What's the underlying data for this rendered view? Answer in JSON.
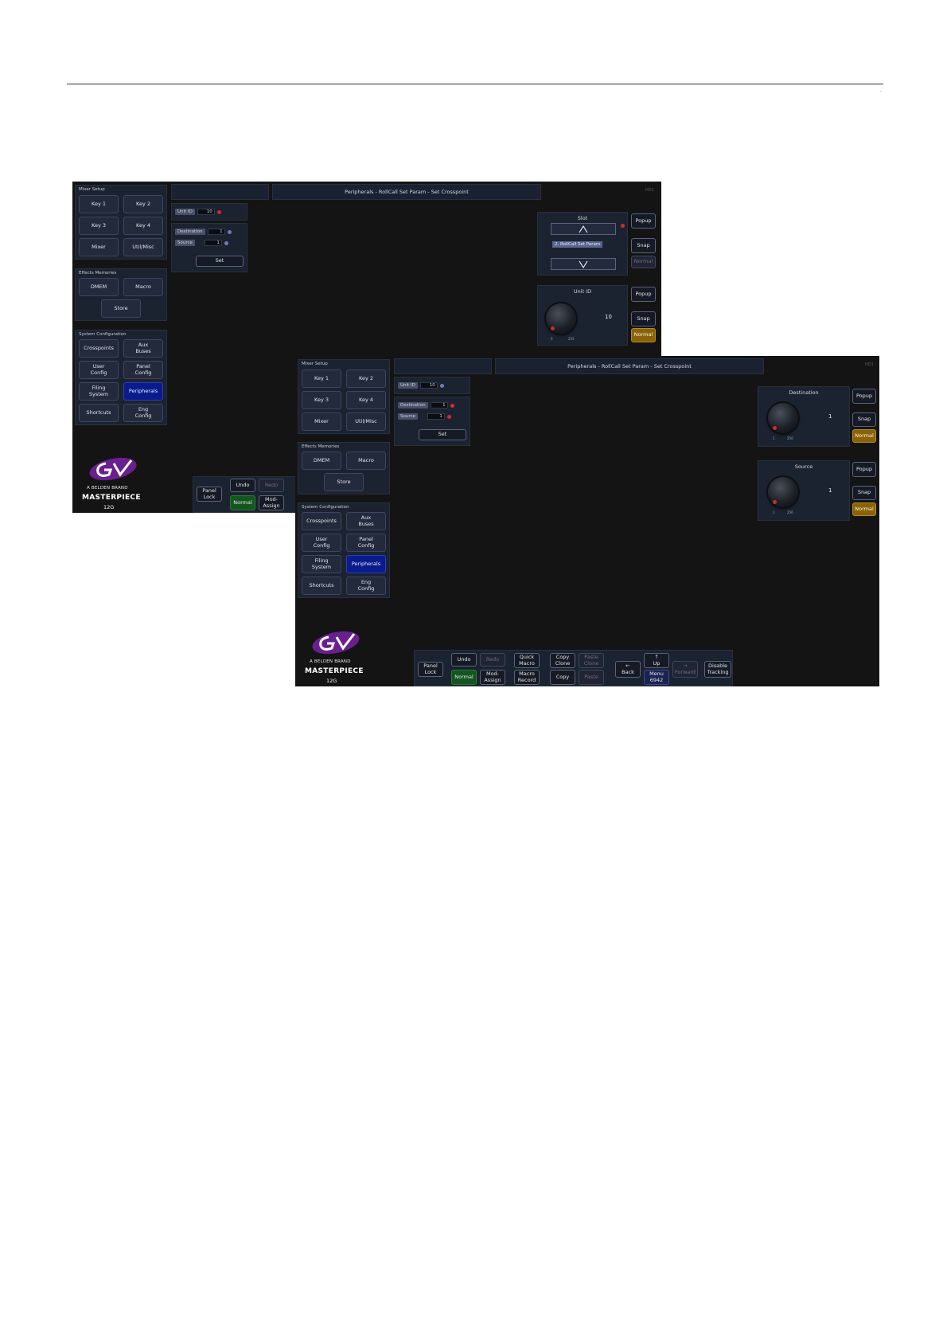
{
  "page": {
    "mark": ","
  },
  "screen1": {
    "header_title": "Peripherals - RollCall Set Param - Set Crosspoint",
    "corner_label": "HD1",
    "mixer_setup": {
      "title": "Mixer Setup",
      "buttons": [
        "Key 1",
        "Key 2",
        "Key 3",
        "Key 4",
        "Mixer",
        "Util/Misc"
      ]
    },
    "effects_memories": {
      "title": "Effects Memories",
      "buttons": [
        "DMEM",
        "Macro",
        "Store"
      ]
    },
    "system_config": {
      "title": "System Configuration",
      "buttons": [
        "Crosspoints",
        "Aux\nBuses",
        "User\nConfig",
        "Panel\nConfig",
        "Filing\nSystem",
        "Peripherals",
        "Shortcuts",
        "Eng\nConfig"
      ]
    },
    "params": {
      "unit_id_label": "Unit ID",
      "unit_id_value": "10",
      "dest_label": "Destination",
      "dest_value": "1",
      "source_label": "Source",
      "source_value": "1",
      "set_label": "Set"
    },
    "slot": {
      "title": "Slot",
      "selected": "2. RollCall Set Param",
      "popup": "Popup",
      "snap": "Snap",
      "normal": "Normal"
    },
    "unit_id_knob": {
      "title": "Unit ID",
      "value": "10",
      "min": "0",
      "max": "255",
      "popup": "Popup",
      "snap": "Snap",
      "normal": "Normal"
    },
    "bottom": {
      "panel_lock": "Panel\nLock",
      "undo": "Undo",
      "redo": "Redo",
      "normal": "Normal",
      "mod_assign": "Mod-\nAssign"
    },
    "brand": {
      "sub": "A BELDEN BRAND",
      "main": "MASTERPIECE",
      "model": "12G"
    }
  },
  "screen2": {
    "header_title": "Peripherals - RollCall Set Param - Set Crosspoint",
    "corner_label": "HD1",
    "mixer_setup": {
      "title": "Mixer Setup",
      "buttons": [
        "Key 1",
        "Key 2",
        "Key 3",
        "Key 4",
        "Mixer",
        "Util/Misc"
      ]
    },
    "effects_memories": {
      "title": "Effects Memories",
      "buttons": [
        "DMEM",
        "Macro",
        "Store"
      ]
    },
    "system_config": {
      "title": "System Configuration",
      "buttons": [
        "Crosspoints",
        "Aux\nBuses",
        "User\nConfig",
        "Panel\nConfig",
        "Filing\nSystem",
        "Peripherals",
        "Shortcuts",
        "Eng\nConfig"
      ]
    },
    "params": {
      "unit_id_label": "Unit ID",
      "unit_id_value": "10",
      "dest_label": "Destination",
      "dest_value": "1",
      "source_label": "Source",
      "source_value": "1",
      "set_label": "Set"
    },
    "destination_knob": {
      "title": "Destination",
      "value": "1",
      "min": "1",
      "max": "256",
      "popup": "Popup",
      "snap": "Snap",
      "normal": "Normal"
    },
    "source_knob": {
      "title": "Source",
      "value": "1",
      "min": "1",
      "max": "256",
      "popup": "Popup",
      "snap": "Snap",
      "normal": "Normal"
    },
    "bottom": {
      "panel_lock": "Panel\nLock",
      "undo": "Undo",
      "redo": "Redo",
      "normal": "Normal",
      "mod_assign": "Mod-\nAssign",
      "quick_macro": "Quick\nMacro",
      "macro_record": "Macro\nRecord",
      "copy_clone": "Copy\nClone",
      "paste_clone": "Paste\nClone",
      "copy": "Copy",
      "paste": "Paste",
      "back": "Back",
      "up": "Up",
      "menu": "Menu\n6942",
      "forward": "Forward",
      "disable_tracking": "Disable\nTracking"
    },
    "brand": {
      "sub": "A BELDEN BRAND",
      "main": "MASTERPIECE",
      "model": "12G"
    }
  }
}
